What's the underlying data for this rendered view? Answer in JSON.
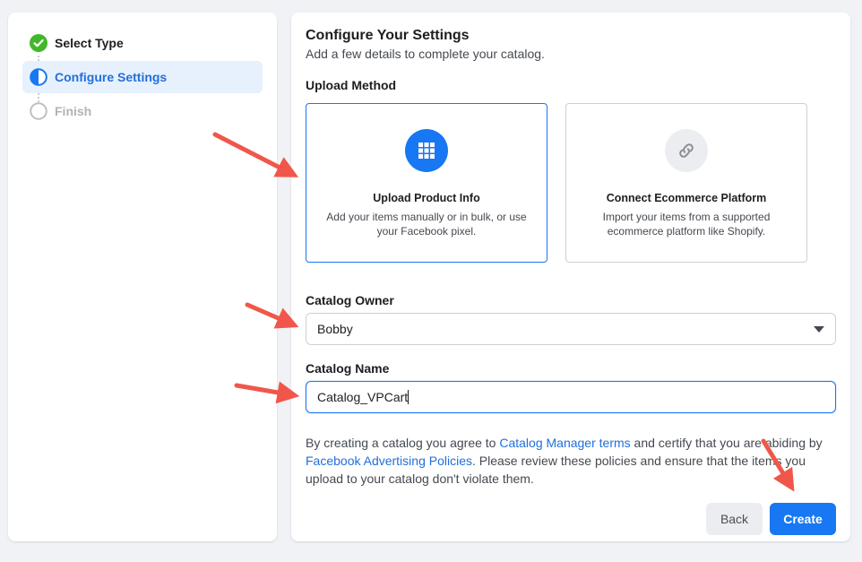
{
  "steps": [
    {
      "label": "Select Type",
      "state": "complete"
    },
    {
      "label": "Configure Settings",
      "state": "active"
    },
    {
      "label": "Finish",
      "state": "pending"
    }
  ],
  "main": {
    "title": "Configure Your Settings",
    "subtitle": "Add a few details to complete your catalog.",
    "upload_method_label": "Upload Method",
    "cards": [
      {
        "title": "Upload Product Info",
        "desc": "Add your items manually or in bulk, or use your Facebook pixel.",
        "icon": "grid-icon",
        "selected": true
      },
      {
        "title": "Connect Ecommerce Platform",
        "desc": "Import your items from a supported ecommerce platform like Shopify.",
        "icon": "link-icon",
        "selected": false
      }
    ],
    "catalog_owner_label": "Catalog Owner",
    "catalog_owner_value": "Bobby",
    "catalog_name_label": "Catalog Name",
    "catalog_name_value": "Catalog_VPCart",
    "legal": {
      "part1": "By creating a catalog you agree to ",
      "link1": "Catalog Manager terms",
      "part2": " and certify that you are abiding by ",
      "link2": "Facebook Advertising Policies",
      "part3": ". Please review these policies and ensure that the items you upload to your catalog don't violate them."
    },
    "back_label": "Back",
    "create_label": "Create"
  },
  "colors": {
    "accent": "#1877f2",
    "success": "#42b72a",
    "annotation_arrow": "#f0574a"
  }
}
